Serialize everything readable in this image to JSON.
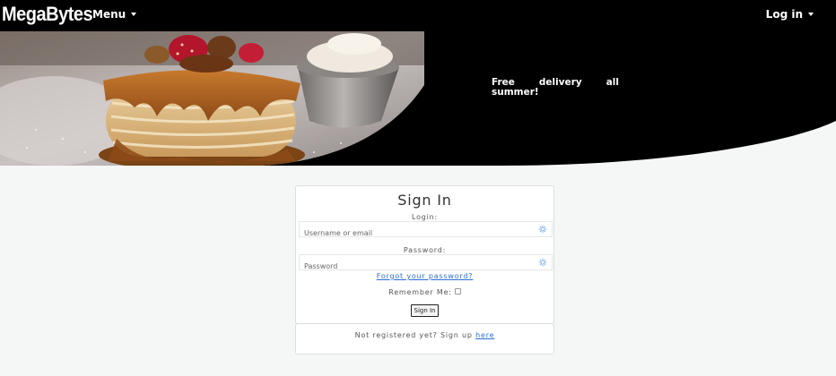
{
  "navbar": {
    "brand": "MegaBytes",
    "menu_label": "Menu",
    "login_label": "Log in"
  },
  "hero": {
    "tagline": "Free delivery all summer!",
    "image": "pancake-stack-photo"
  },
  "signin": {
    "title": "Sign In",
    "login_label": "Login:",
    "login_placeholder": "Username or email",
    "password_label": "Password:",
    "password_placeholder": "Password",
    "field_icon": "key-icon",
    "forgot_link": "Forgot your password?",
    "remember_label": "Remember Me:",
    "remember_checked": false,
    "submit_label": "Sign In"
  },
  "signup": {
    "prompt": "Not registered yet? Sign up",
    "link": "here"
  },
  "colors": {
    "navbar_bg": "#000000",
    "page_bg": "#f5f7f6",
    "link": "#2a6fd6"
  }
}
